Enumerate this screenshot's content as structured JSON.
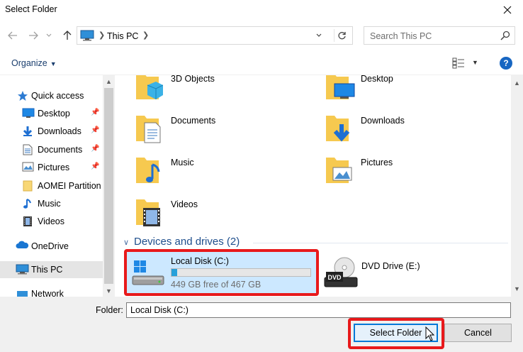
{
  "window": {
    "title": "Select Folder",
    "close_icon": "close-icon"
  },
  "nav": {
    "back_icon": "arrow-left-icon",
    "forward_icon": "arrow-right-icon",
    "recent_icon": "chevron-down-icon",
    "up_icon": "arrow-up-icon",
    "address": {
      "location": "This PC",
      "refresh_icon": "refresh-icon"
    },
    "search": {
      "placeholder": "Search This PC"
    }
  },
  "toolbar": {
    "organize_label": "Organize",
    "help_label": "?"
  },
  "sidebar": {
    "items": [
      {
        "label": "Quick access",
        "icon": "star-icon",
        "pinned": false
      },
      {
        "label": "Desktop",
        "icon": "desktop-icon",
        "pinned": true
      },
      {
        "label": "Downloads",
        "icon": "download-icon",
        "pinned": true
      },
      {
        "label": "Documents",
        "icon": "document-icon",
        "pinned": true
      },
      {
        "label": "Pictures",
        "icon": "picture-icon",
        "pinned": true
      },
      {
        "label": "AOMEI Partition",
        "icon": "folder-icon",
        "pinned": false
      },
      {
        "label": "Music",
        "icon": "music-icon",
        "pinned": false
      },
      {
        "label": "Videos",
        "icon": "video-icon",
        "pinned": false
      },
      {
        "label": "OneDrive",
        "icon": "cloud-icon",
        "pinned": false
      },
      {
        "label": "This PC",
        "icon": "computer-icon",
        "pinned": false,
        "selected": true
      },
      {
        "label": "Network",
        "icon": "network-icon",
        "pinned": false
      }
    ]
  },
  "folders": [
    {
      "name": "3D Objects",
      "icon": "3d-objects-folder-icon"
    },
    {
      "name": "Desktop",
      "icon": "desktop-folder-icon"
    },
    {
      "name": "Documents",
      "icon": "documents-folder-icon"
    },
    {
      "name": "Downloads",
      "icon": "downloads-folder-icon"
    },
    {
      "name": "Music",
      "icon": "music-folder-icon"
    },
    {
      "name": "Pictures",
      "icon": "pictures-folder-icon"
    },
    {
      "name": "Videos",
      "icon": "videos-folder-icon"
    }
  ],
  "devices": {
    "header": "Devices and drives (2)",
    "local_disk": {
      "name": "Local Disk (C:)",
      "free_text": "449 GB free of 467 GB",
      "used_fraction": 0.0385
    },
    "dvd": {
      "name": "DVD Drive (E:)",
      "badge": "DVD"
    }
  },
  "footer": {
    "folder_label": "Folder:",
    "folder_value": "Local Disk (C:)",
    "select_label": "Select Folder",
    "cancel_label": "Cancel"
  },
  "colors": {
    "accent": "#0078d7",
    "highlight": "#e8191b",
    "selection": "#cce8ff"
  }
}
